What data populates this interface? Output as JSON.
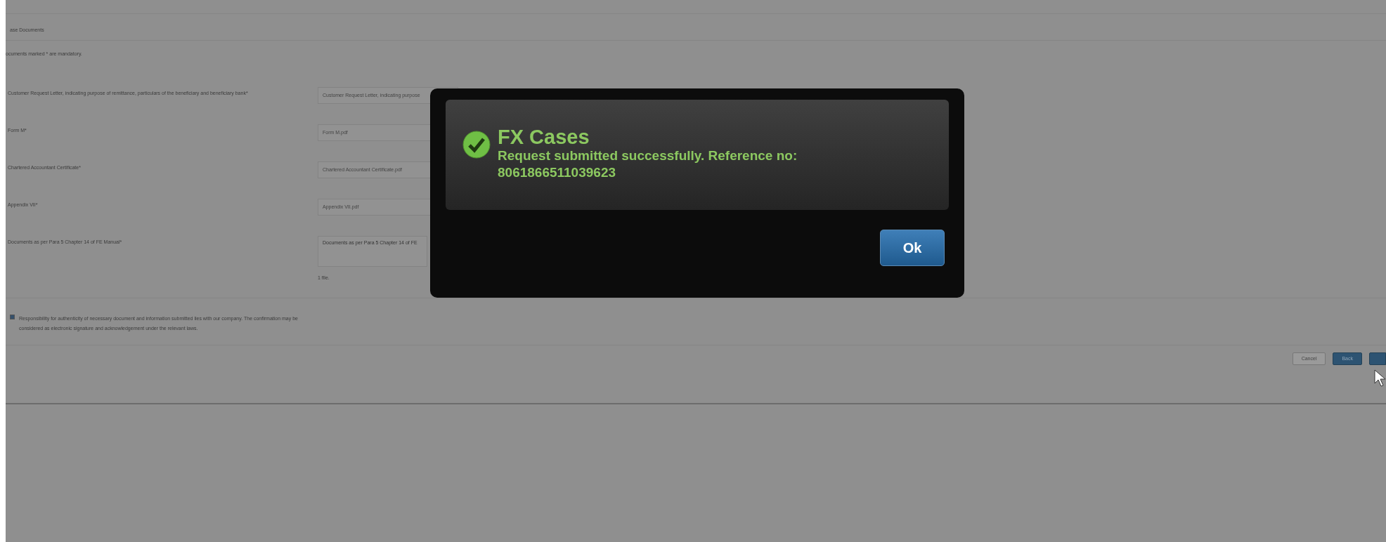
{
  "form": {
    "section_title": "ase Documents",
    "notes": [
      "ocuments marked * are mandatory."
    ],
    "documents": [
      {
        "kind": "file",
        "label": "Customer Request Letter, indicating purpose of remittance, particulars of the beneficiary and beneficiary bank*",
        "value": "Customer Request Letter, indicating purpose"
      },
      {
        "kind": "file",
        "label": "Form M*",
        "value": "Form M.pdf"
      },
      {
        "kind": "file",
        "label": "Chartered Accountant Certificate*",
        "value": "Chartered Accountant Certificate.pdf"
      },
      {
        "kind": "file",
        "label": "Appendix VII*",
        "value": "Appendix VII.pdf"
      },
      {
        "kind": "textarea",
        "label": "Documents as per Para 5 Chapter 14 of FE Manual*",
        "placeholder": "Documents as per Para 5 Chapter 14 of FE",
        "hint": "1 file."
      }
    ],
    "declaration": {
      "checked": true,
      "text": "Responsibility for authenticity of necessary document and information submitted lies with our company. The confirmation may be considered as electronic signature and acknowledgement under the relevant laws."
    },
    "buttons": [
      {
        "label": "Cancel",
        "kind": "secondary"
      },
      {
        "label": "Back",
        "kind": "primary"
      }
    ]
  },
  "dialog": {
    "title": "FX Cases",
    "message": "Request submitted successfully. Reference no: 8061866511039623",
    "button": "Ok"
  }
}
